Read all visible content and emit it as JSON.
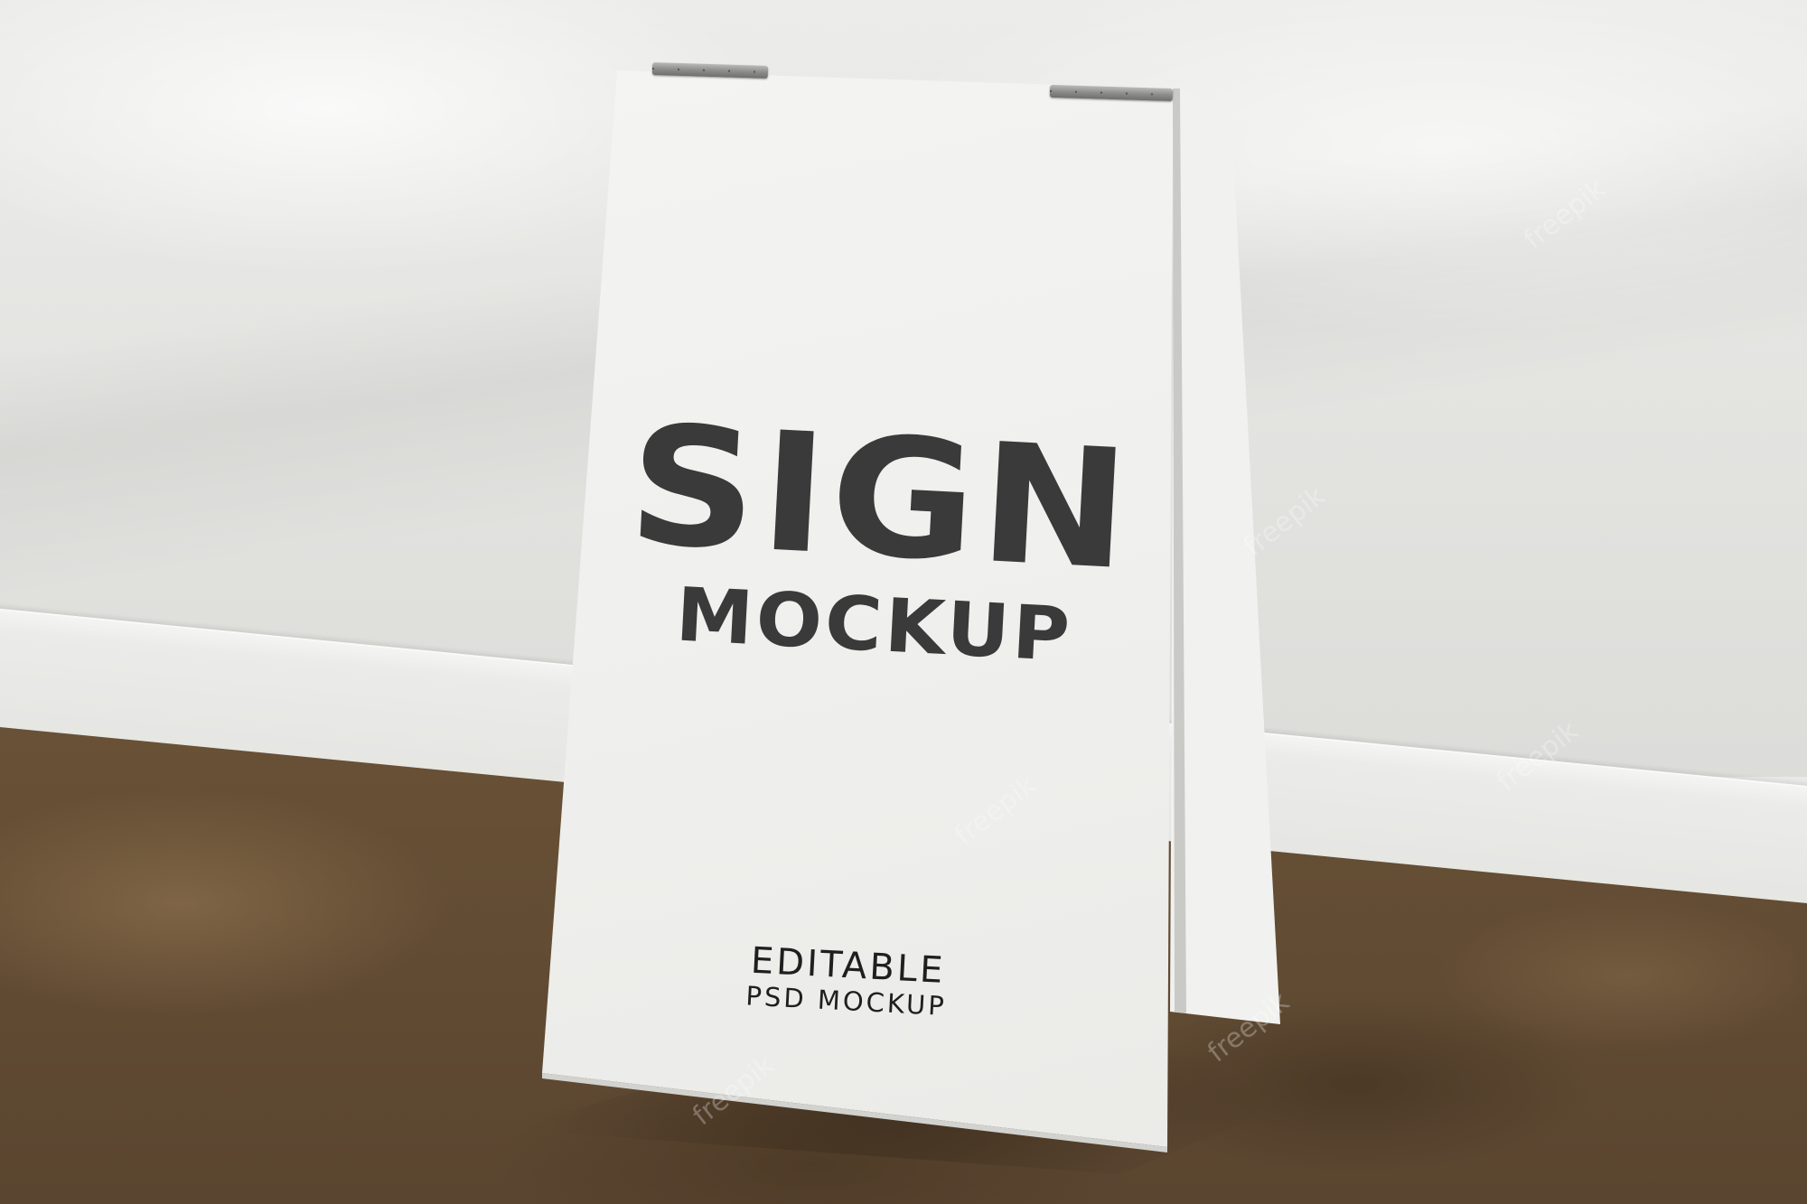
{
  "sign": {
    "headline_line1": "SIGN",
    "headline_line2": "MOCKUP",
    "subline_line1": "EDITABLE",
    "subline_line2": "PSD MOCKUP"
  },
  "watermark": {
    "text": "freepik"
  },
  "colors": {
    "wall": "#e6e6e3",
    "sign_board": "#f2f2f0",
    "headline_text": "#3a3a3a",
    "floor": "#6e5638"
  }
}
